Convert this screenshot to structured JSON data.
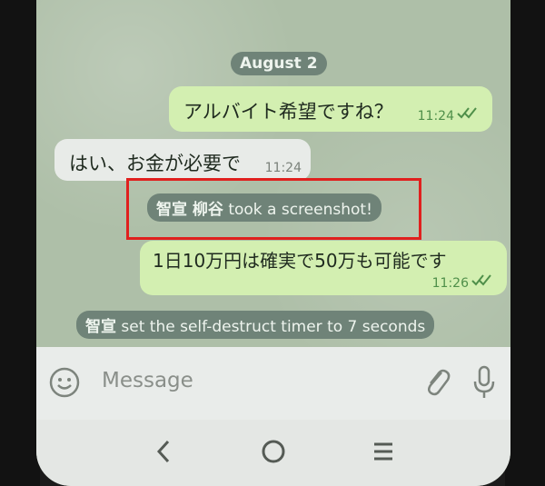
{
  "date_separator": "August 2",
  "messages": [
    {
      "direction": "outgoing",
      "text": "アルバイト希望ですね？",
      "time": "11:24",
      "status": "read"
    },
    {
      "direction": "incoming",
      "text": "はい、お金が必要で",
      "time": "11:24"
    },
    {
      "direction": "outgoing",
      "text": "1日10万円は確実で50万も可能です",
      "time": "11:26",
      "status": "read"
    }
  ],
  "service_messages": {
    "screenshot": {
      "user": "智宣 柳谷",
      "action": "took a screenshot!"
    },
    "timer": {
      "user": "智宣",
      "action": "set the self-destruct timer to 7 seconds"
    }
  },
  "composer": {
    "placeholder": "Message"
  },
  "icons": {
    "emoji": "smiley-icon",
    "attach": "paperclip-icon",
    "mic": "microphone-icon",
    "ticks": "double-check-icon",
    "nav_back": "chevron-left-icon",
    "nav_home": "circle-home-icon",
    "nav_recent": "recent-apps-icon"
  },
  "colors": {
    "outgoing_bubble": "#d3efb1",
    "incoming_bubble": "#e8ebe8",
    "service_pill": "#6f8378",
    "highlight_box": "#e0201e",
    "read_ticks": "#4f8f4a"
  }
}
